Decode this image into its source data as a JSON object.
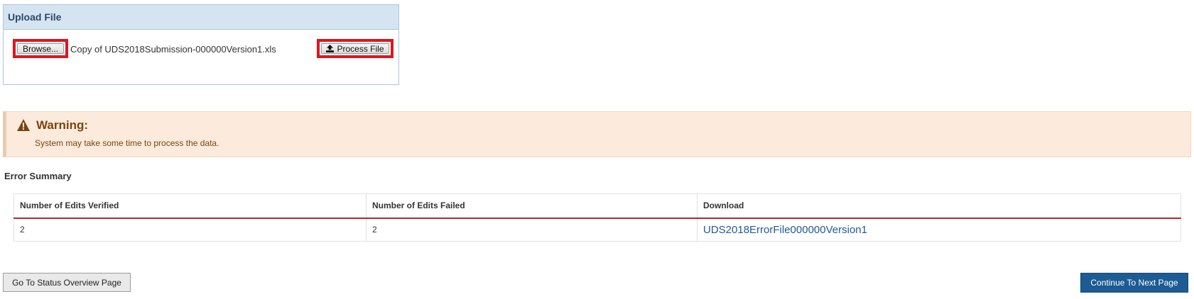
{
  "upload": {
    "title": "Upload File",
    "browse_label": "Browse...",
    "file_name": "Copy of UDS2018Submission-000000Version1.xls",
    "process_label": "Process File"
  },
  "warning": {
    "title": "Warning:",
    "message": "System may take some time to process the data."
  },
  "error_summary": {
    "title": "Error Summary",
    "columns": [
      "Number of Edits Verified",
      "Number of Edits Failed",
      "Download"
    ],
    "rows": [
      [
        "2",
        "2",
        "UDS2018ErrorFile000000Version1"
      ]
    ]
  },
  "footer": {
    "status_button": "Go To Status Overview Page",
    "continue_button": "Continue To Next Page"
  },
  "colors": {
    "highlight": "#e0141e",
    "primary": "#1c5b93",
    "warning_bg": "#fcebdc",
    "link": "#205a94"
  }
}
